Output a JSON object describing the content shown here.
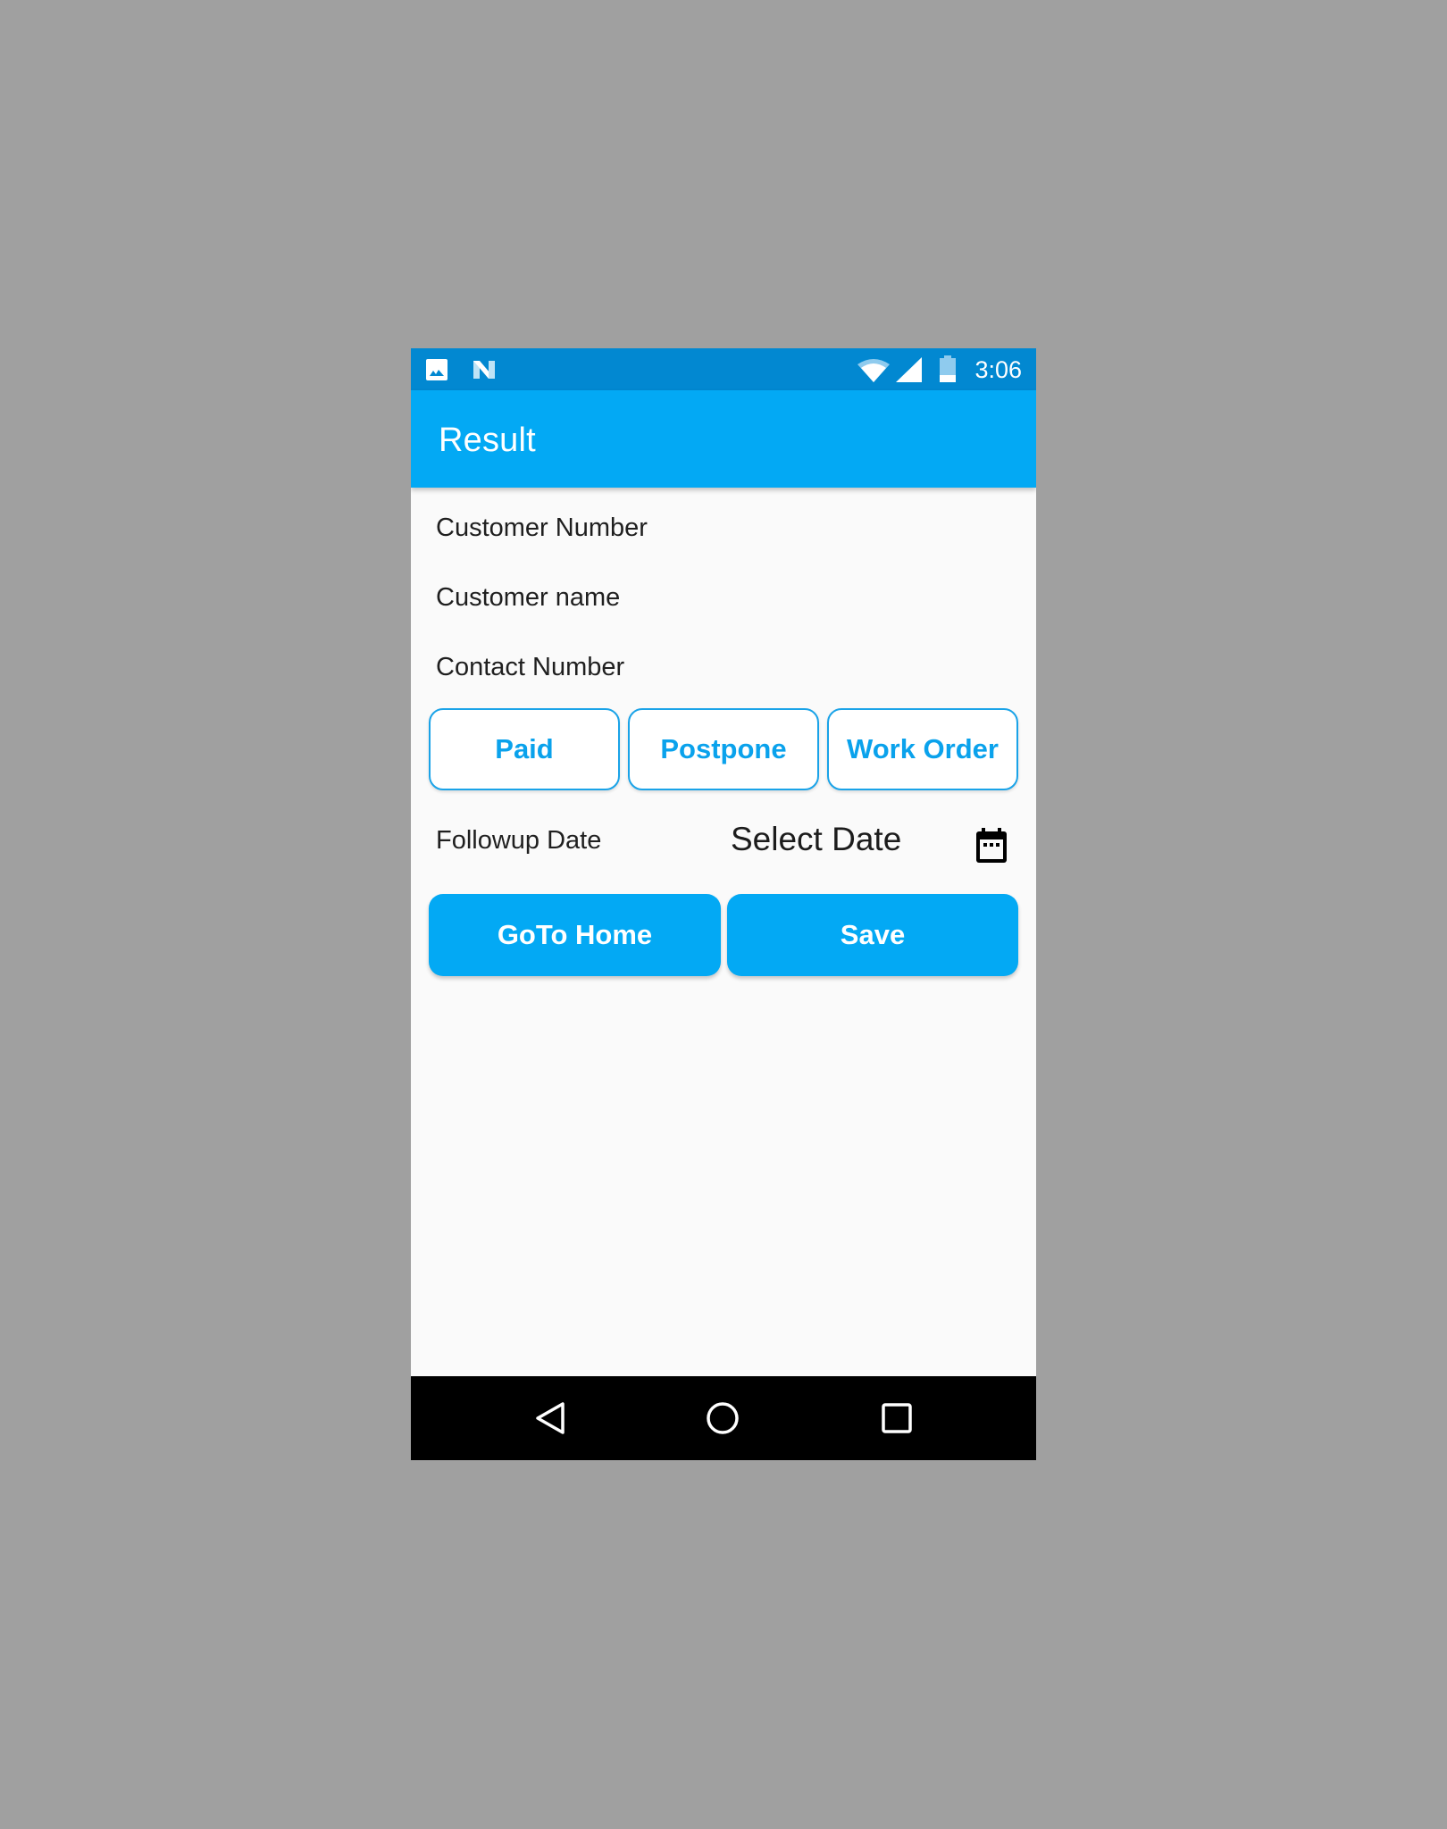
{
  "status_bar": {
    "time": "3:06",
    "left_icons": [
      "image-notification-icon",
      "n-notification-icon"
    ],
    "right_icons": [
      "wifi-icon",
      "cellular-signal-icon",
      "battery-icon"
    ]
  },
  "toolbar": {
    "title": "Result"
  },
  "fields": {
    "customer_number_label": "Customer Number",
    "customer_name_label": "Customer name",
    "contact_number_label": "Contact Number"
  },
  "actions": {
    "paid": "Paid",
    "postpone": "Postpone",
    "work_order": "Work Order"
  },
  "followup": {
    "label": "Followup Date",
    "date_value": "Select Date",
    "icon": "calendar-icon"
  },
  "buttons": {
    "goto_home": "GoTo Home",
    "save": "Save"
  },
  "nav_bar": {
    "icons": [
      "back-icon",
      "home-icon",
      "recents-icon"
    ]
  },
  "colors": {
    "status_bar": "#0288d1",
    "primary": "#03a9f4",
    "accent_text": "#0aa2ec",
    "background": "#fafafa",
    "nav_bar": "#000000"
  }
}
